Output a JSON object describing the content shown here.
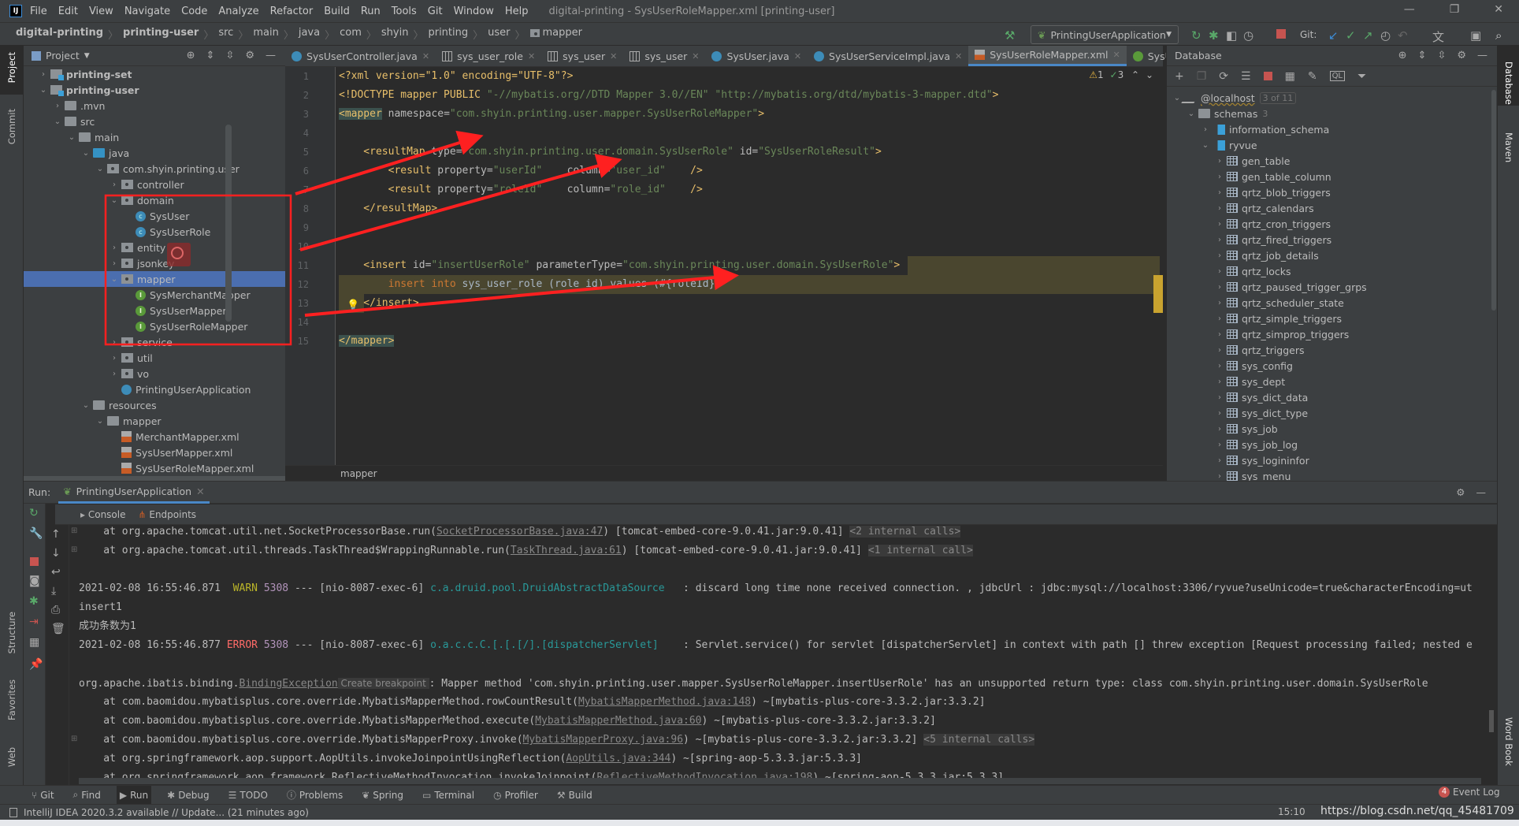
{
  "menubar": {
    "items": [
      "File",
      "Edit",
      "View",
      "Navigate",
      "Code",
      "Analyze",
      "Refactor",
      "Build",
      "Run",
      "Tools",
      "Git",
      "Window",
      "Help"
    ],
    "window_title": "digital-printing - SysUserRoleMapper.xml [printing-user]",
    "window_controls": [
      "—",
      "❐",
      "✕"
    ]
  },
  "breadcrumb": [
    "digital-printing",
    "printing-user",
    "src",
    "main",
    "java",
    "com",
    "shyin",
    "printing",
    "user",
    "mapper"
  ],
  "toolbar": {
    "run_config": "PrintingUserApplication",
    "git_label": "Git:"
  },
  "left_strip": {
    "project": "Project",
    "commit": "Commit",
    "structure": "Structure",
    "favorites": "Favorites",
    "web": "Web"
  },
  "right_strip": {
    "database": "Database",
    "maven": "Maven",
    "word_book": "Word Book"
  },
  "project": {
    "title": "Project",
    "tree": [
      {
        "label": "printing-set",
        "depth": 1,
        "icon": "module",
        "arrow": "collapsed",
        "bold": true
      },
      {
        "label": "printing-user",
        "depth": 1,
        "icon": "module",
        "arrow": "expanded",
        "bold": true
      },
      {
        "label": ".mvn",
        "depth": 2,
        "icon": "folder",
        "arrow": "collapsed"
      },
      {
        "label": "src",
        "depth": 2,
        "icon": "folder",
        "arrow": "expanded"
      },
      {
        "label": "main",
        "depth": 3,
        "icon": "folder",
        "arrow": "expanded"
      },
      {
        "label": "java",
        "depth": 4,
        "icon": "source-folder",
        "arrow": "expanded"
      },
      {
        "label": "com.shyin.printing.user",
        "depth": 5,
        "icon": "package",
        "arrow": "expanded"
      },
      {
        "label": "controller",
        "depth": 6,
        "icon": "package",
        "arrow": "collapsed"
      },
      {
        "label": "domain",
        "depth": 6,
        "icon": "package",
        "arrow": "expanded"
      },
      {
        "label": "SysUser",
        "depth": 7,
        "icon": "class"
      },
      {
        "label": "SysUserRole",
        "depth": 7,
        "icon": "class"
      },
      {
        "label": "entity",
        "depth": 6,
        "icon": "package",
        "arrow": "collapsed"
      },
      {
        "label": "jsonkey",
        "depth": 6,
        "icon": "package",
        "arrow": "collapsed"
      },
      {
        "label": "mapper",
        "depth": 6,
        "icon": "package",
        "arrow": "expanded",
        "selected": true
      },
      {
        "label": "SysMerchantMapper",
        "depth": 7,
        "icon": "interface"
      },
      {
        "label": "SysUserMapper",
        "depth": 7,
        "icon": "interface"
      },
      {
        "label": "SysUserRoleMapper",
        "depth": 7,
        "icon": "interface"
      },
      {
        "label": "service",
        "depth": 6,
        "icon": "package",
        "arrow": "collapsed"
      },
      {
        "label": "util",
        "depth": 6,
        "icon": "package",
        "arrow": "collapsed"
      },
      {
        "label": "vo",
        "depth": 6,
        "icon": "package",
        "arrow": "collapsed"
      },
      {
        "label": "PrintingUserApplication",
        "depth": 6,
        "icon": "spring-app"
      },
      {
        "label": "resources",
        "depth": 4,
        "icon": "resources-folder",
        "arrow": "expanded"
      },
      {
        "label": "mapper",
        "depth": 5,
        "icon": "folder",
        "arrow": "expanded"
      },
      {
        "label": "MerchantMapper.xml",
        "depth": 6,
        "icon": "xml"
      },
      {
        "label": "SysUserMapper.xml",
        "depth": 6,
        "icon": "xml"
      },
      {
        "label": "SysUserRoleMapper.xml",
        "depth": 6,
        "icon": "xml"
      }
    ]
  },
  "editor": {
    "tabs": [
      {
        "label": "SysUserController.java",
        "icon": "class"
      },
      {
        "label": "sys_user_role",
        "icon": "table"
      },
      {
        "label": "sys_user",
        "icon": "table"
      },
      {
        "label": "sys_user",
        "icon": "table"
      },
      {
        "label": "SysUser.java",
        "icon": "class"
      },
      {
        "label": "SysUserServiceImpl.java",
        "icon": "class"
      },
      {
        "label": "SysUserRoleMapper.xml",
        "icon": "xml",
        "active": true
      },
      {
        "label": "SysUserR",
        "icon": "interface",
        "overflow": true
      }
    ],
    "inspections": {
      "warnings": "1",
      "ok": "3"
    },
    "lines": [
      [
        {
          "t": "<?xml version=\"1.0\" encoding=\"UTF-8\"?>",
          "c": "pi"
        }
      ],
      [
        {
          "t": "<!DOCTYPE mapper PUBLIC ",
          "c": "tag"
        },
        {
          "t": "\"-//mybatis.org//DTD Mapper 3.0//EN\" \"http://mybatis.org/dtd/mybatis-3-mapper.dtd\"",
          "c": "val"
        },
        {
          "t": ">",
          "c": "tag"
        }
      ],
      [
        {
          "t": "<mapper",
          "c": "tagbg"
        },
        {
          "t": " namespace=",
          "c": "attr"
        },
        {
          "t": "\"com.shyin.printing.user.mapper.SysUserRoleMapper\"",
          "c": "val"
        },
        {
          "t": ">",
          "c": "tag"
        }
      ],
      [],
      [
        {
          "t": "    <resultMap",
          "c": "tag"
        },
        {
          "t": " type=",
          "c": "attr"
        },
        {
          "t": "\"com.shyin.printing.user.domain.SysUserRole\"",
          "c": "val"
        },
        {
          "t": " id=",
          "c": "attr"
        },
        {
          "t": "\"SysUserRoleResult\"",
          "c": "val"
        },
        {
          "t": ">",
          "c": "tag"
        }
      ],
      [
        {
          "t": "        <result",
          "c": "tag"
        },
        {
          "t": " property=",
          "c": "attr"
        },
        {
          "t": "\"userId\"",
          "c": "val"
        },
        {
          "t": "    column=",
          "c": "attr"
        },
        {
          "t": "\"user_id\"",
          "c": "val"
        },
        {
          "t": "    />",
          "c": "tag"
        }
      ],
      [
        {
          "t": "        <result",
          "c": "tag"
        },
        {
          "t": " property=",
          "c": "attr"
        },
        {
          "t": "\"roleId\"",
          "c": "val"
        },
        {
          "t": "    column=",
          "c": "attr"
        },
        {
          "t": "\"role_id\"",
          "c": "val"
        },
        {
          "t": "    />",
          "c": "tag"
        }
      ],
      [
        {
          "t": "    </resultMap>",
          "c": "tag"
        }
      ],
      [],
      [],
      [
        {
          "t": "    <insert",
          "c": "tag"
        },
        {
          "t": " id=",
          "c": "attr"
        },
        {
          "t": "\"insertUserRole\"",
          "c": "val"
        },
        {
          "t": " parameterType=",
          "c": "attr"
        },
        {
          "t": "\"com.shyin.printing.user.domain.SysUserRole\"",
          "c": "val"
        },
        {
          "t": ">",
          "c": "tag"
        }
      ],
      [
        {
          "t": "        insert into ",
          "c": "kw"
        },
        {
          "t": "sys_user_role (role_id) values (#{roleId})",
          "c": "id"
        }
      ],
      [
        {
          "t": "    </insert>",
          "c": "tag"
        }
      ],
      [],
      [
        {
          "t": "</mapper>",
          "c": "tagbg"
        }
      ]
    ],
    "breadcrumb": "mapper"
  },
  "database": {
    "title": "Database",
    "tree": [
      {
        "label": "@localhost",
        "depth": 0,
        "icon": "connection",
        "arrow": "expanded",
        "badge": "3 of 11"
      },
      {
        "label": "schemas",
        "depth": 1,
        "icon": "folder",
        "arrow": "expanded",
        "count": "3"
      },
      {
        "label": "information_schema",
        "depth": 2,
        "icon": "schema",
        "arrow": "collapsed"
      },
      {
        "label": "ryvue",
        "depth": 2,
        "icon": "schema",
        "arrow": "expanded"
      },
      {
        "label": "gen_table",
        "depth": 3,
        "icon": "table",
        "arrow": "collapsed"
      },
      {
        "label": "gen_table_column",
        "depth": 3,
        "icon": "table",
        "arrow": "collapsed"
      },
      {
        "label": "qrtz_blob_triggers",
        "depth": 3,
        "icon": "table",
        "arrow": "collapsed"
      },
      {
        "label": "qrtz_calendars",
        "depth": 3,
        "icon": "table",
        "arrow": "collapsed"
      },
      {
        "label": "qrtz_cron_triggers",
        "depth": 3,
        "icon": "table",
        "arrow": "collapsed"
      },
      {
        "label": "qrtz_fired_triggers",
        "depth": 3,
        "icon": "table",
        "arrow": "collapsed"
      },
      {
        "label": "qrtz_job_details",
        "depth": 3,
        "icon": "table",
        "arrow": "collapsed"
      },
      {
        "label": "qrtz_locks",
        "depth": 3,
        "icon": "table",
        "arrow": "collapsed"
      },
      {
        "label": "qrtz_paused_trigger_grps",
        "depth": 3,
        "icon": "table",
        "arrow": "collapsed"
      },
      {
        "label": "qrtz_scheduler_state",
        "depth": 3,
        "icon": "table",
        "arrow": "collapsed"
      },
      {
        "label": "qrtz_simple_triggers",
        "depth": 3,
        "icon": "table",
        "arrow": "collapsed"
      },
      {
        "label": "qrtz_simprop_triggers",
        "depth": 3,
        "icon": "table",
        "arrow": "collapsed"
      },
      {
        "label": "qrtz_triggers",
        "depth": 3,
        "icon": "table",
        "arrow": "collapsed"
      },
      {
        "label": "sys_config",
        "depth": 3,
        "icon": "table",
        "arrow": "collapsed"
      },
      {
        "label": "sys_dept",
        "depth": 3,
        "icon": "table",
        "arrow": "collapsed"
      },
      {
        "label": "sys_dict_data",
        "depth": 3,
        "icon": "table",
        "arrow": "collapsed"
      },
      {
        "label": "sys_dict_type",
        "depth": 3,
        "icon": "table",
        "arrow": "collapsed"
      },
      {
        "label": "sys_job",
        "depth": 3,
        "icon": "table",
        "arrow": "collapsed"
      },
      {
        "label": "sys_job_log",
        "depth": 3,
        "icon": "table",
        "arrow": "collapsed"
      },
      {
        "label": "sys_logininfor",
        "depth": 3,
        "icon": "table",
        "arrow": "collapsed"
      },
      {
        "label": "sys_menu",
        "depth": 3,
        "icon": "table",
        "arrow": "collapsed"
      }
    ]
  },
  "run": {
    "label": "Run:",
    "tab": "PrintingUserApplication",
    "subtabs": [
      "Console",
      "Endpoints"
    ],
    "lines": [
      {
        "fold": true,
        "segs": [
          {
            "t": "    at org.apache.tomcat.util.net.SocketProcessorBase.run("
          },
          {
            "t": "SocketProcessorBase.java:47",
            "c": "link"
          },
          {
            "t": ") [tomcat-embed-core-9.0.41.jar:9.0.41] "
          },
          {
            "t": "<2 internal calls>",
            "c": "hint"
          }
        ]
      },
      {
        "fold": true,
        "segs": [
          {
            "t": "    at org.apache.tomcat.util.threads.TaskThread$WrappingRunnable.run("
          },
          {
            "t": "TaskThread.java:61",
            "c": "link"
          },
          {
            "t": ") [tomcat-embed-core-9.0.41.jar:9.0.41] "
          },
          {
            "t": "<1 internal call>",
            "c": "hint"
          }
        ]
      },
      {
        "segs": []
      },
      {
        "segs": [
          {
            "t": "2021-02-08 16:55:46.871  "
          },
          {
            "t": "WARN",
            "c": "warn"
          },
          {
            "t": " "
          },
          {
            "t": "5308",
            "c": "pid"
          },
          {
            "t": " --- [nio-8087-exec-6] "
          },
          {
            "t": "c.a.druid.pool.DruidAbstractDataSource",
            "c": "cls"
          },
          {
            "t": "   : discard long time none received connection. , jdbcUrl : jdbc:mysql://localhost:3306/ryvue?useUnicode=true&characterEncoding=ut"
          }
        ]
      },
      {
        "segs": [
          {
            "t": "insert1"
          }
        ]
      },
      {
        "segs": [
          {
            "t": "成功条数为1"
          }
        ]
      },
      {
        "segs": [
          {
            "t": "2021-02-08 16:55:46.877 "
          },
          {
            "t": "ERROR",
            "c": "err"
          },
          {
            "t": " "
          },
          {
            "t": "5308",
            "c": "pid"
          },
          {
            "t": " --- [nio-8087-exec-6] "
          },
          {
            "t": "o.a.c.c.C.[.[.[/].[dispatcherServlet]",
            "c": "cls"
          },
          {
            "t": "    : Servlet.service() for servlet [dispatcherServlet] in context with path [] threw exception [Request processing failed; nested e"
          }
        ]
      },
      {
        "segs": []
      },
      {
        "segs": [
          {
            "t": "org.apache.ibatis.binding."
          },
          {
            "t": "BindingException",
            "c": "link"
          },
          {
            "t": " Create breakpoint ",
            "c": "hint2"
          },
          {
            "t": ": Mapper method 'com.shyin.printing.user.mapper.SysUserRoleMapper.insertUserRole' has an unsupported return type: class com.shyin.printing.user.domain.SysUserRole"
          }
        ]
      },
      {
        "segs": [
          {
            "t": "    at com.baomidou.mybatisplus.core.override.MybatisMapperMethod.rowCountResult("
          },
          {
            "t": "MybatisMapperMethod.java:148",
            "c": "link"
          },
          {
            "t": ") ~[mybatis-plus-core-3.3.2.jar:3.3.2]"
          }
        ]
      },
      {
        "segs": [
          {
            "t": "    at com.baomidou.mybatisplus.core.override.MybatisMapperMethod.execute("
          },
          {
            "t": "MybatisMapperMethod.java:60",
            "c": "link"
          },
          {
            "t": ") ~[mybatis-plus-core-3.3.2.jar:3.3.2]"
          }
        ]
      },
      {
        "fold": true,
        "segs": [
          {
            "t": "    at com.baomidou.mybatisplus.core.override.MybatisMapperProxy.invoke("
          },
          {
            "t": "MybatisMapperProxy.java:96",
            "c": "link"
          },
          {
            "t": ") ~[mybatis-plus-core-3.3.2.jar:3.3.2] "
          },
          {
            "t": "<5 internal calls>",
            "c": "hint"
          }
        ]
      },
      {
        "segs": [
          {
            "t": "    at org.springframework.aop.support.AopUtils.invokeJoinpointUsingReflection("
          },
          {
            "t": "AopUtils.java:344",
            "c": "link"
          },
          {
            "t": ") ~[spring-aop-5.3.3.jar:5.3.3]"
          }
        ]
      },
      {
        "segs": [
          {
            "t": "    at org.springframework.aop.framework.ReflectiveMethodInvocation.invokeJoinpoint("
          },
          {
            "t": "ReflectiveMethodInvocation.java:198",
            "c": "link"
          },
          {
            "t": ") ~[spring-aop-5.3.3.jar:5.3.3]"
          }
        ]
      }
    ]
  },
  "tool_strip": [
    "Git",
    "Find",
    "Run",
    "Debug",
    "TODO",
    "Problems",
    "Spring",
    "Terminal",
    "Profiler",
    "Build"
  ],
  "event_log": {
    "count": "4",
    "label": "Event Log"
  },
  "status": {
    "message": "IntelliJ IDEA 2020.3.2 available // Update... (21 minutes ago)",
    "position": "15:10",
    "watermark": "https://blog.csdn.net/qq_45481709"
  },
  "colors": {
    "annotation": "#ff2020",
    "selection": "#4b6eaf",
    "editor_bg": "#2b2b2b",
    "panel_bg": "#3c3f41"
  }
}
